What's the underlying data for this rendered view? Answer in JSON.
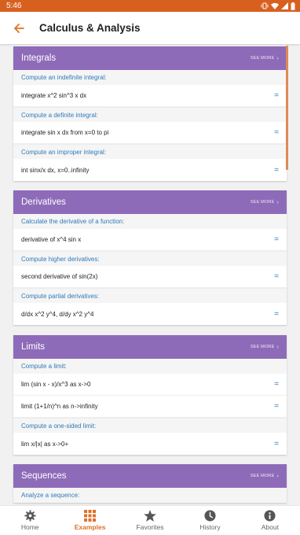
{
  "status": {
    "time": "5:46"
  },
  "appbar": {
    "title": "Calculus & Analysis"
  },
  "see_more": "SEE MORE",
  "cards": [
    {
      "title": "Integrals",
      "sections": [
        {
          "label": "Compute an indefinite integral:",
          "examples": [
            "integrate x^2 sin^3 x dx"
          ]
        },
        {
          "label": "Compute a definite integral:",
          "examples": [
            "integrate sin x dx from x=0 to pi"
          ]
        },
        {
          "label": "Compute an improper integral:",
          "examples": [
            "int sinx/x dx, x=0..infinity"
          ]
        }
      ]
    },
    {
      "title": "Derivatives",
      "sections": [
        {
          "label": "Calculate the derivative of a function:",
          "examples": [
            "derivative of x^4 sin x"
          ]
        },
        {
          "label": "Compute higher derivatives:",
          "examples": [
            "second derivative of sin(2x)"
          ]
        },
        {
          "label": "Compute partial derivatives:",
          "examples": [
            "d/dx x^2 y^4, d/dy x^2 y^4"
          ]
        }
      ]
    },
    {
      "title": "Limits",
      "sections": [
        {
          "label": "Compute a limit:",
          "examples": [
            "lim (sin x - x)/x^3 as x->0",
            "limit (1+1/n)^n as n->infinity"
          ]
        },
        {
          "label": "Compute a one-sided limit:",
          "examples": [
            "lim x/|x| as x->0+"
          ]
        }
      ]
    },
    {
      "title": "Sequences",
      "sections": [
        {
          "label": "Analyze a sequence:",
          "examples": []
        }
      ]
    }
  ],
  "equals": "=",
  "nav": [
    {
      "label": "Home",
      "icon": "gear-icon"
    },
    {
      "label": "Examples",
      "icon": "grid-icon",
      "active": true
    },
    {
      "label": "Favorites",
      "icon": "star-icon"
    },
    {
      "label": "History",
      "icon": "clock-icon"
    },
    {
      "label": "About",
      "icon": "info-icon"
    }
  ],
  "colors": {
    "accent": "#e07128",
    "status_bar": "#d8601f",
    "card_header": "#8e6bb8",
    "link": "#2e7ab8"
  }
}
